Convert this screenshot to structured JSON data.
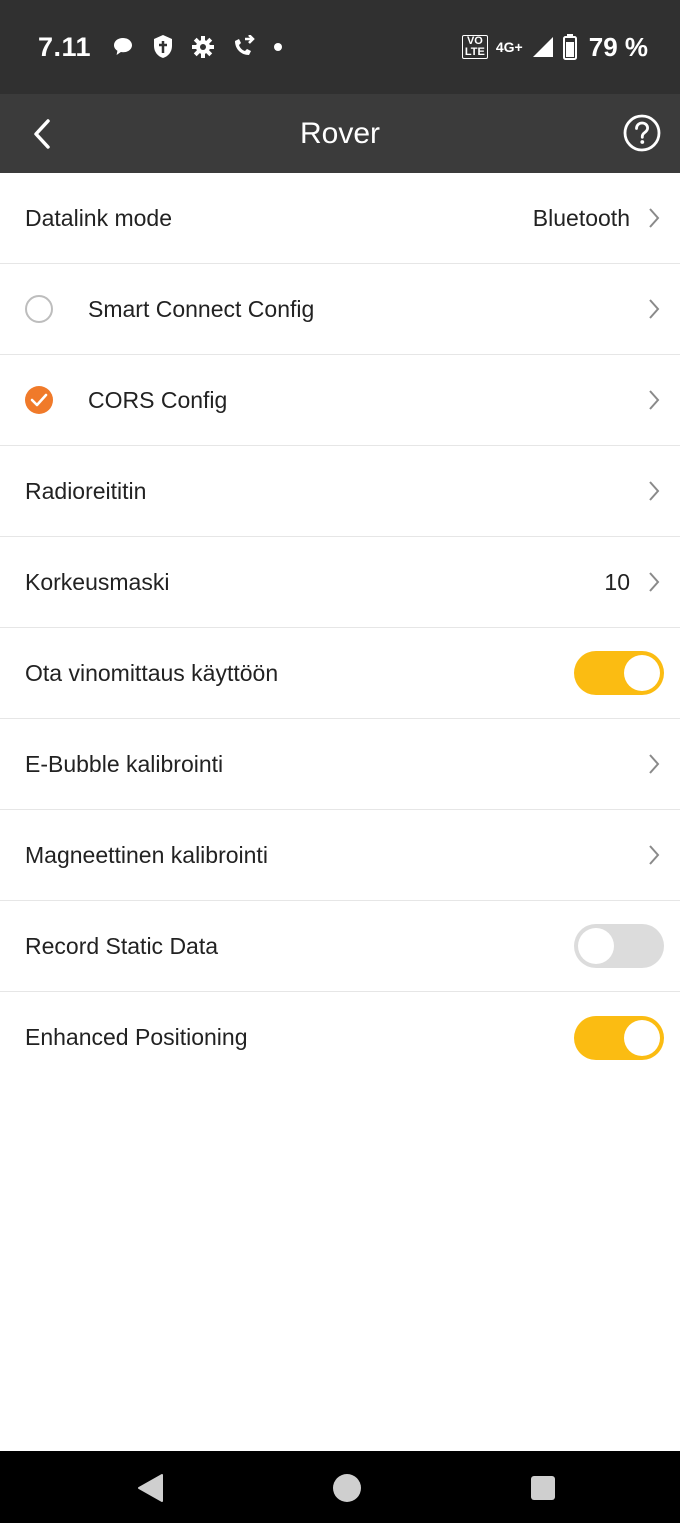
{
  "status_bar": {
    "time": "7.11",
    "left_icons": [
      "chat-bubble-icon",
      "shield-icon",
      "gear-icon",
      "call-forward-icon",
      "dot-icon"
    ],
    "lte_label_top": "VO",
    "lte_label_bottom": "LTE",
    "network_label": "4G+",
    "battery_percent": "79 %"
  },
  "header": {
    "title": "Rover",
    "back_icon": "chevron-left-icon",
    "help_icon": "help-circle-icon"
  },
  "rows": {
    "datalink": {
      "label": "Datalink mode",
      "value": "Bluetooth"
    },
    "smart_connect": {
      "label": "Smart Connect Config",
      "checked": false
    },
    "cors": {
      "label": "CORS Config",
      "checked": true
    },
    "radio_router": {
      "label": "Radioreititin"
    },
    "elevation_mask": {
      "label": "Korkeusmaski",
      "value": "10"
    },
    "tilt": {
      "label": "Ota vinomittaus käyttöön",
      "enabled": true
    },
    "ebubble": {
      "label": "E-Bubble kalibrointi"
    },
    "magnetic": {
      "label": "Magneettinen kalibrointi"
    },
    "record_static": {
      "label": "Record Static Data",
      "enabled": false
    },
    "enhanced": {
      "label": "Enhanced Positioning",
      "enabled": true
    }
  },
  "colors": {
    "status_bar_bg": "#303030",
    "header_bg": "#3b3b3b",
    "accent_orange": "#f07a2a",
    "toggle_on": "#fbbc12",
    "toggle_off": "#dcdcdc"
  },
  "nav_bar": {
    "back": "triangle-back-icon",
    "home": "circle-home-icon",
    "recents": "square-recents-icon"
  }
}
